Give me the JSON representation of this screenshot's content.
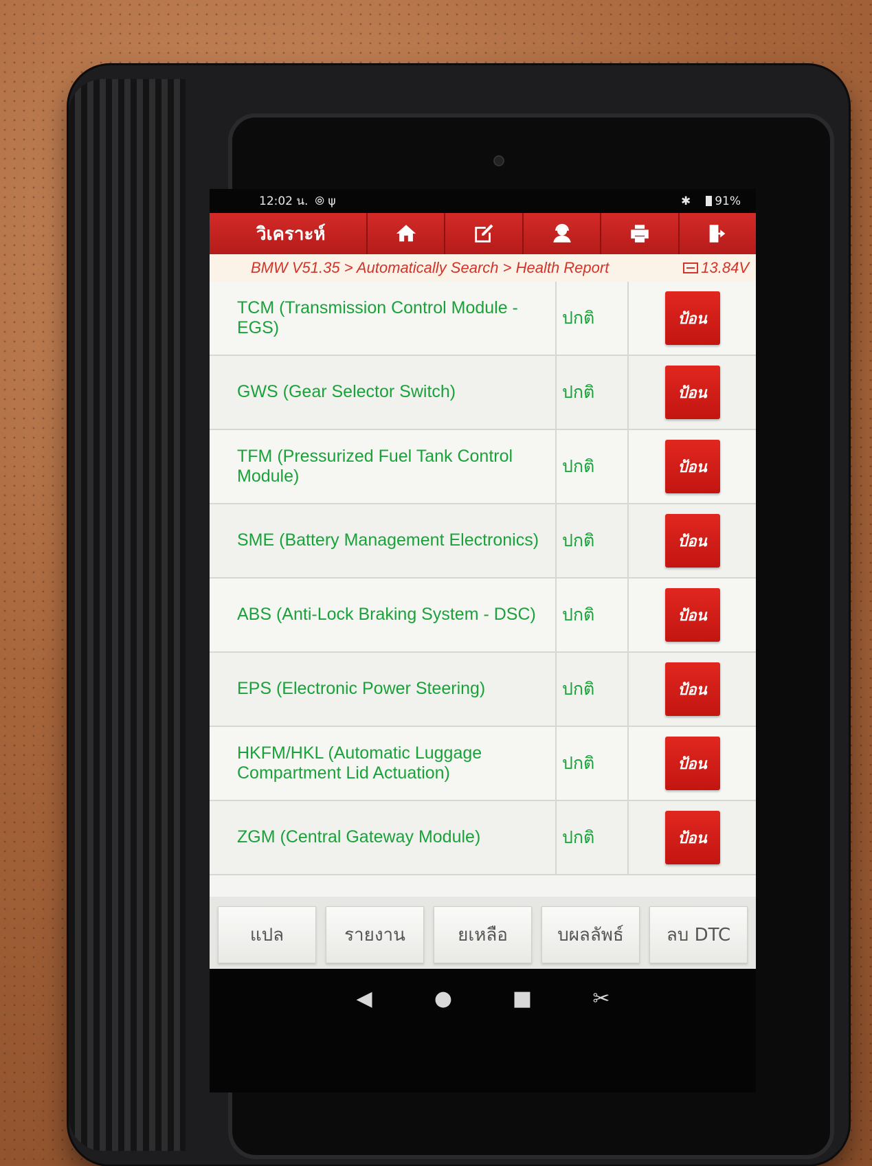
{
  "status_bar": {
    "time": "12:02 น.",
    "battery": "91%",
    "bluetooth_icon": "bluetooth-icon",
    "usb_icon": "usb-icon"
  },
  "app_bar": {
    "title": "วิเคราะห์",
    "nav_icons": [
      "home-icon",
      "edit-icon",
      "support-icon",
      "print-icon",
      "exit-icon"
    ]
  },
  "breadcrumb": {
    "path": "BMW V51.35 > Automatically Search > Health Report",
    "voltage": "13.84V"
  },
  "modules": [
    {
      "name": "TCM (Transmission Control Module - EGS)",
      "status": "ปกติ",
      "action": "ป้อน"
    },
    {
      "name": "GWS (Gear Selector Switch)",
      "status": "ปกติ",
      "action": "ป้อน"
    },
    {
      "name": "TFM (Pressurized Fuel Tank Control Module)",
      "status": "ปกติ",
      "action": "ป้อน"
    },
    {
      "name": "SME (Battery Management Electronics)",
      "status": "ปกติ",
      "action": "ป้อน"
    },
    {
      "name": "ABS (Anti-Lock Braking System - DSC)",
      "status": "ปกติ",
      "action": "ป้อน"
    },
    {
      "name": "EPS (Electronic Power Steering)",
      "status": "ปกติ",
      "action": "ป้อน"
    },
    {
      "name": "HKFM/HKL (Automatic Luggage Compartment Lid Actuation)",
      "status": "ปกติ",
      "action": "ป้อน"
    },
    {
      "name": "ZGM (Central Gateway Module)",
      "status": "ปกติ",
      "action": "ป้อน"
    }
  ],
  "bottom_buttons": [
    "แปล",
    "รายงาน",
    "ยเหลือ",
    "บผลลัพธ์",
    "ลบ DTC"
  ],
  "system_nav": [
    "◀",
    "●",
    "■",
    "✂"
  ]
}
